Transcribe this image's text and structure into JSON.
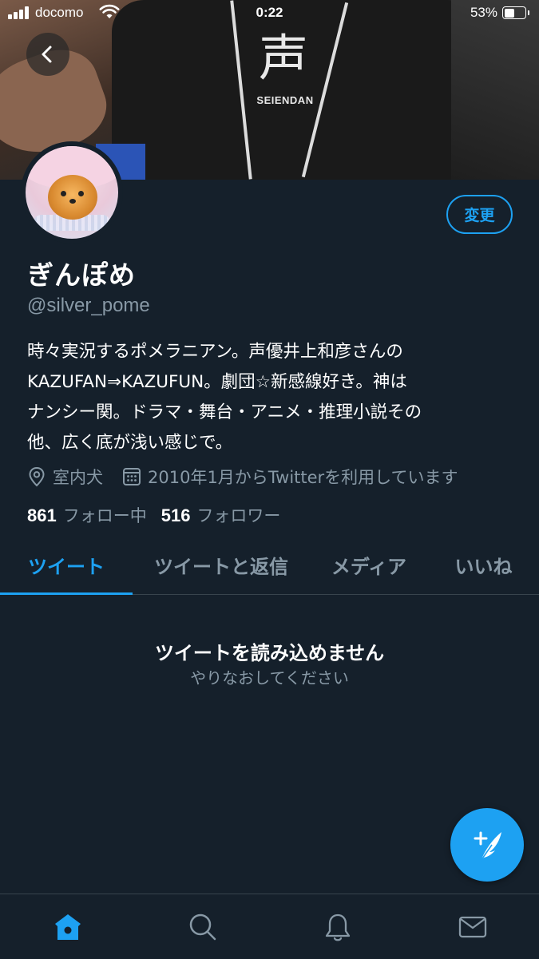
{
  "status_bar": {
    "carrier": "docomo",
    "time": "0:22",
    "battery_percent": "53%",
    "battery_level": 0.53
  },
  "header_photo": {
    "shirt_kanji": "声",
    "shirt_brand": "SEIENDAN"
  },
  "profile": {
    "display_name": "ぎんぽめ",
    "screen_name": "@silver_pome",
    "edit_label": "変更",
    "bio_lines": [
      "時々実況するポメラニアン。声優井上和彦さんの",
      "KAZUFAN⇒KAZUFUN。劇団☆新感線好き。神は",
      "ナンシー関。ドラマ・舞台・アニメ・推理小説その",
      "他、広く底が浅い感じで。"
    ],
    "location": "室内犬",
    "joined": "2010年1月からTwitterを利用しています",
    "following_count": "861",
    "following_label": "フォロー中",
    "followers_count": "516",
    "followers_label": "フォロワー"
  },
  "tabs": [
    {
      "label": "ツイート",
      "active": true
    },
    {
      "label": "ツイートと返信",
      "active": false
    },
    {
      "label": "メディア",
      "active": false
    },
    {
      "label": "いいね",
      "active": false
    }
  ],
  "empty_state": {
    "title": "ツイートを読み込めません",
    "subtitle": "やりなおしてください"
  },
  "icons": {
    "back": "chevron-left-icon",
    "compose": "compose-tweet-icon",
    "nav": [
      "home-icon",
      "search-icon",
      "bell-icon",
      "mail-icon"
    ],
    "location": "location-pin-icon",
    "calendar": "calendar-icon"
  },
  "colors": {
    "background": "#15202b",
    "accent": "#1da1f2",
    "secondary_text": "#8899a6",
    "divider": "#38444d"
  }
}
